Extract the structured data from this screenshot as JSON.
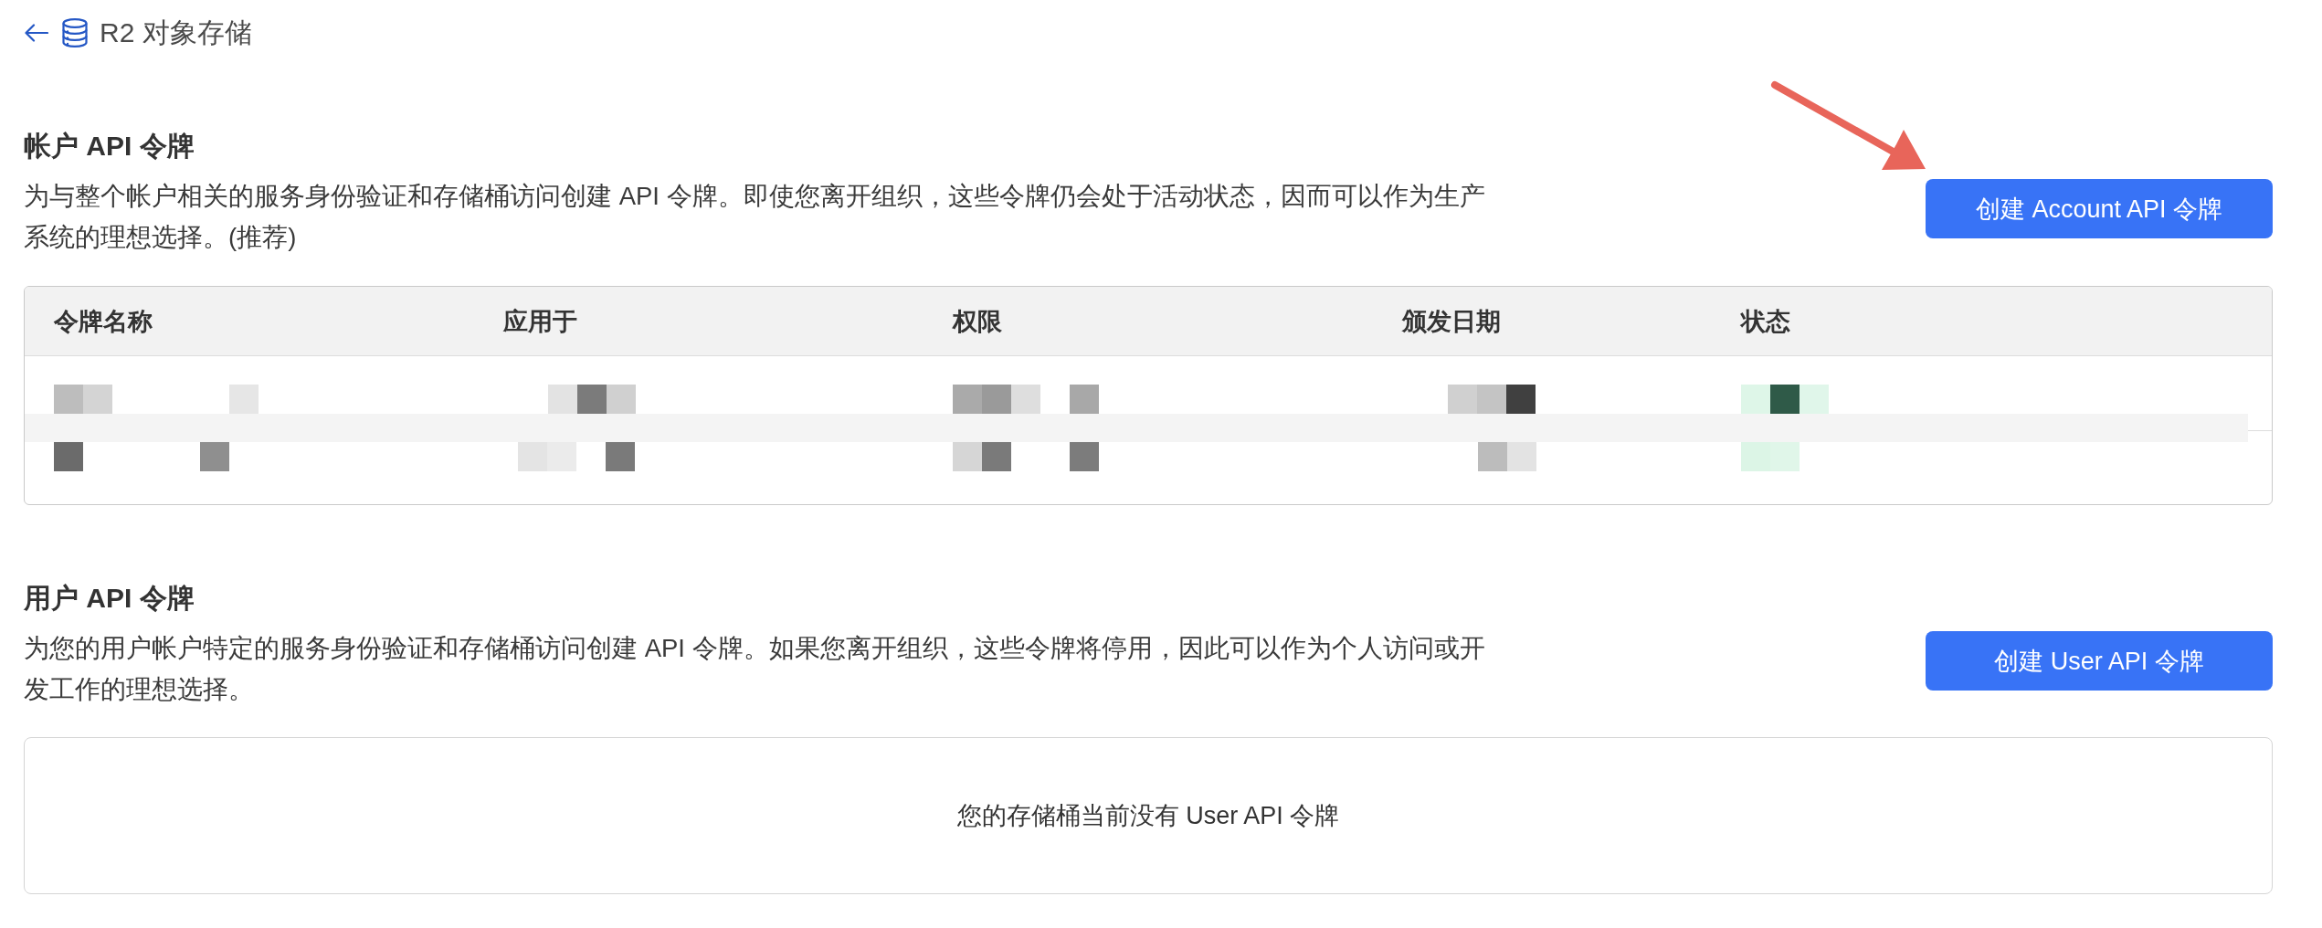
{
  "header": {
    "title": "R2 对象存储"
  },
  "sections": [
    {
      "kind": "table",
      "title": "帐户 API 令牌",
      "description": "为与整个帐户相关的服务身份验证和存储桶访问创建 API 令牌。即使您离开组织，这些令牌仍会处于活动状态，因而可以作为生产系统的理想选择。(推荐)",
      "button": "创建 Account API 令牌",
      "table": {
        "columns": [
          "令牌名称",
          "应用于",
          "权限",
          "颁发日期",
          "状态"
        ],
        "rows": [
          {
            "kind": "pixelated"
          },
          {
            "kind": "pixelated"
          }
        ]
      }
    },
    {
      "kind": "empty",
      "title": "用户 API 令牌",
      "description": "为您的用户帐户特定的服务身份验证和存储桶访问创建 API 令牌。如果您离开组织，这些令牌将停用，因此可以作为个人访问或开发工作的理想选择。",
      "button": "创建 User API 令牌",
      "empty_message": "您的存储桶当前没有 User API 令牌"
    }
  ]
}
